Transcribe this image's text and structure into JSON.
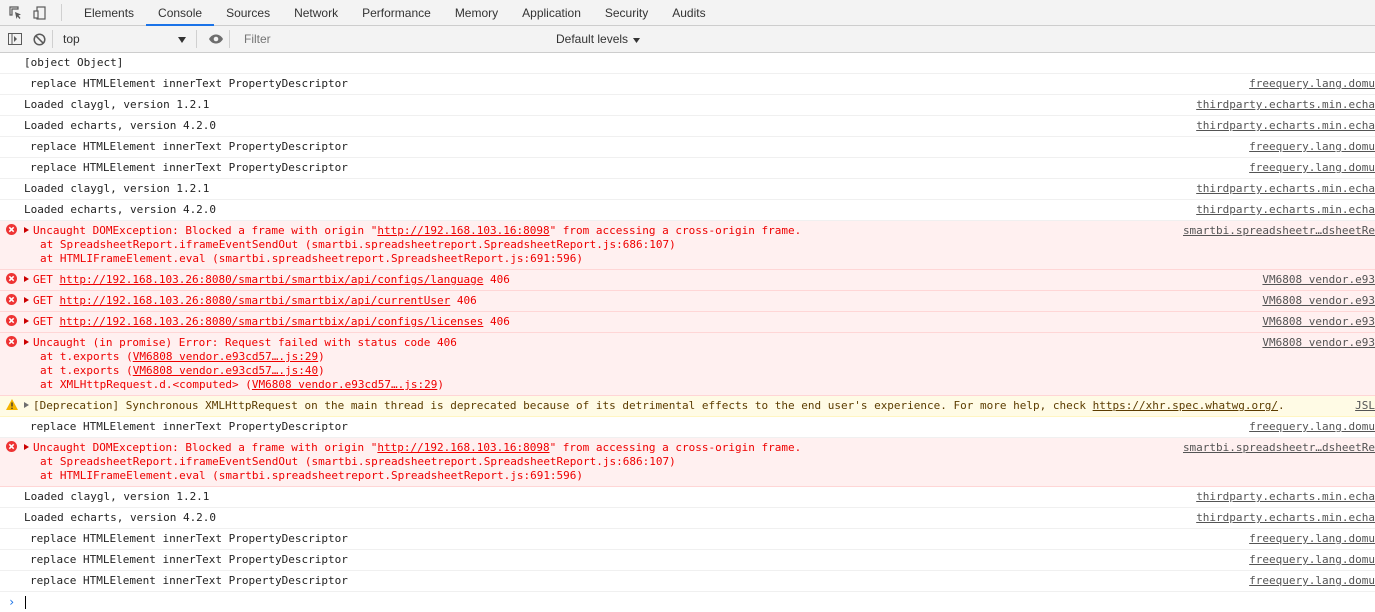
{
  "tabs": [
    "Elements",
    "Console",
    "Sources",
    "Network",
    "Performance",
    "Memory",
    "Application",
    "Security",
    "Audits"
  ],
  "active_tab": "Console",
  "toolbar": {
    "context": "top",
    "filter_placeholder": "Filter",
    "levels": "Default levels"
  },
  "messages": [
    {
      "type": "log",
      "indent": false,
      "text": "[object Object]",
      "source": ""
    },
    {
      "type": "log",
      "indent": true,
      "text": "replace HTMLElement innerText PropertyDescriptor",
      "source": "freequery.lang.domu"
    },
    {
      "type": "log",
      "indent": false,
      "text": "Loaded claygl, version 1.2.1",
      "source": "thirdparty.echarts.min.echa"
    },
    {
      "type": "log",
      "indent": false,
      "text": "Loaded echarts, version 4.2.0",
      "source": "thirdparty.echarts.min.echa"
    },
    {
      "type": "log",
      "indent": true,
      "text": "replace HTMLElement innerText PropertyDescriptor",
      "source": "freequery.lang.domu"
    },
    {
      "type": "log",
      "indent": true,
      "text": "replace HTMLElement innerText PropertyDescriptor",
      "source": "freequery.lang.domu"
    },
    {
      "type": "log",
      "indent": false,
      "text": "Loaded claygl, version 1.2.1",
      "source": "thirdparty.echarts.min.echa"
    },
    {
      "type": "log",
      "indent": false,
      "text": "Loaded echarts, version 4.2.0",
      "source": "thirdparty.echarts.min.echa"
    },
    {
      "type": "error",
      "text": "Uncaught DOMException: Blocked a frame with origin \"http://192.168.103.16:8098\" from accessing a cross-origin frame.",
      "stack": [
        "at SpreadsheetReport.iframeEventSendOut (smartbi.spreadsheetreport.SpreadsheetReport.js:686:107)",
        "at HTMLIFrameElement.eval (smartbi.spreadsheetreport.SpreadsheetReport.js:691:596)"
      ],
      "source": "smartbi.spreadsheetr…dsheetRe"
    },
    {
      "type": "error",
      "text": "GET http://192.168.103.26:8080/smartbi/smartbix/api/configs/language 406",
      "stack": [],
      "source": "VM6808 vendor.e93"
    },
    {
      "type": "error",
      "text": "GET http://192.168.103.26:8080/smartbi/smartbix/api/currentUser 406",
      "stack": [],
      "source": "VM6808 vendor.e93"
    },
    {
      "type": "error",
      "text": "GET http://192.168.103.26:8080/smartbi/smartbix/api/configs/licenses 406",
      "stack": [],
      "source": "VM6808 vendor.e93"
    },
    {
      "type": "error",
      "text": "Uncaught (in promise) Error: Request failed with status code 406",
      "stack": [
        "at t.exports (VM6808 vendor.e93cd57….js:29)",
        "at t.exports (VM6808 vendor.e93cd57….js:40)",
        "at XMLHttpRequest.d.<computed> (VM6808 vendor.e93cd57….js:29)"
      ],
      "source": "VM6808 vendor.e93"
    },
    {
      "type": "warning",
      "text": "[Deprecation] Synchronous XMLHttpRequest on the main thread is deprecated because of its detrimental effects to the end user's experience. For more help, check https://xhr.spec.whatwg.org/.",
      "stack": [],
      "source": "JSL"
    },
    {
      "type": "log",
      "indent": true,
      "text": "replace HTMLElement innerText PropertyDescriptor",
      "source": "freequery.lang.domu"
    },
    {
      "type": "error",
      "text": "Uncaught DOMException: Blocked a frame with origin \"http://192.168.103.16:8098\" from accessing a cross-origin frame.",
      "stack": [
        "at SpreadsheetReport.iframeEventSendOut (smartbi.spreadsheetreport.SpreadsheetReport.js:686:107)",
        "at HTMLIFrameElement.eval (smartbi.spreadsheetreport.SpreadsheetReport.js:691:596)"
      ],
      "source": "smartbi.spreadsheetr…dsheetRe"
    },
    {
      "type": "log",
      "indent": false,
      "text": "Loaded claygl, version 1.2.1",
      "source": "thirdparty.echarts.min.echa"
    },
    {
      "type": "log",
      "indent": false,
      "text": "Loaded echarts, version 4.2.0",
      "source": "thirdparty.echarts.min.echa"
    },
    {
      "type": "log",
      "indent": true,
      "text": "replace HTMLElement innerText PropertyDescriptor",
      "source": "freequery.lang.domu"
    },
    {
      "type": "log",
      "indent": true,
      "text": "replace HTMLElement innerText PropertyDescriptor",
      "source": "freequery.lang.domu"
    },
    {
      "type": "log",
      "indent": true,
      "text": "replace HTMLElement innerText PropertyDescriptor",
      "source": "freequery.lang.domu"
    }
  ],
  "prompt_symbol": "›"
}
